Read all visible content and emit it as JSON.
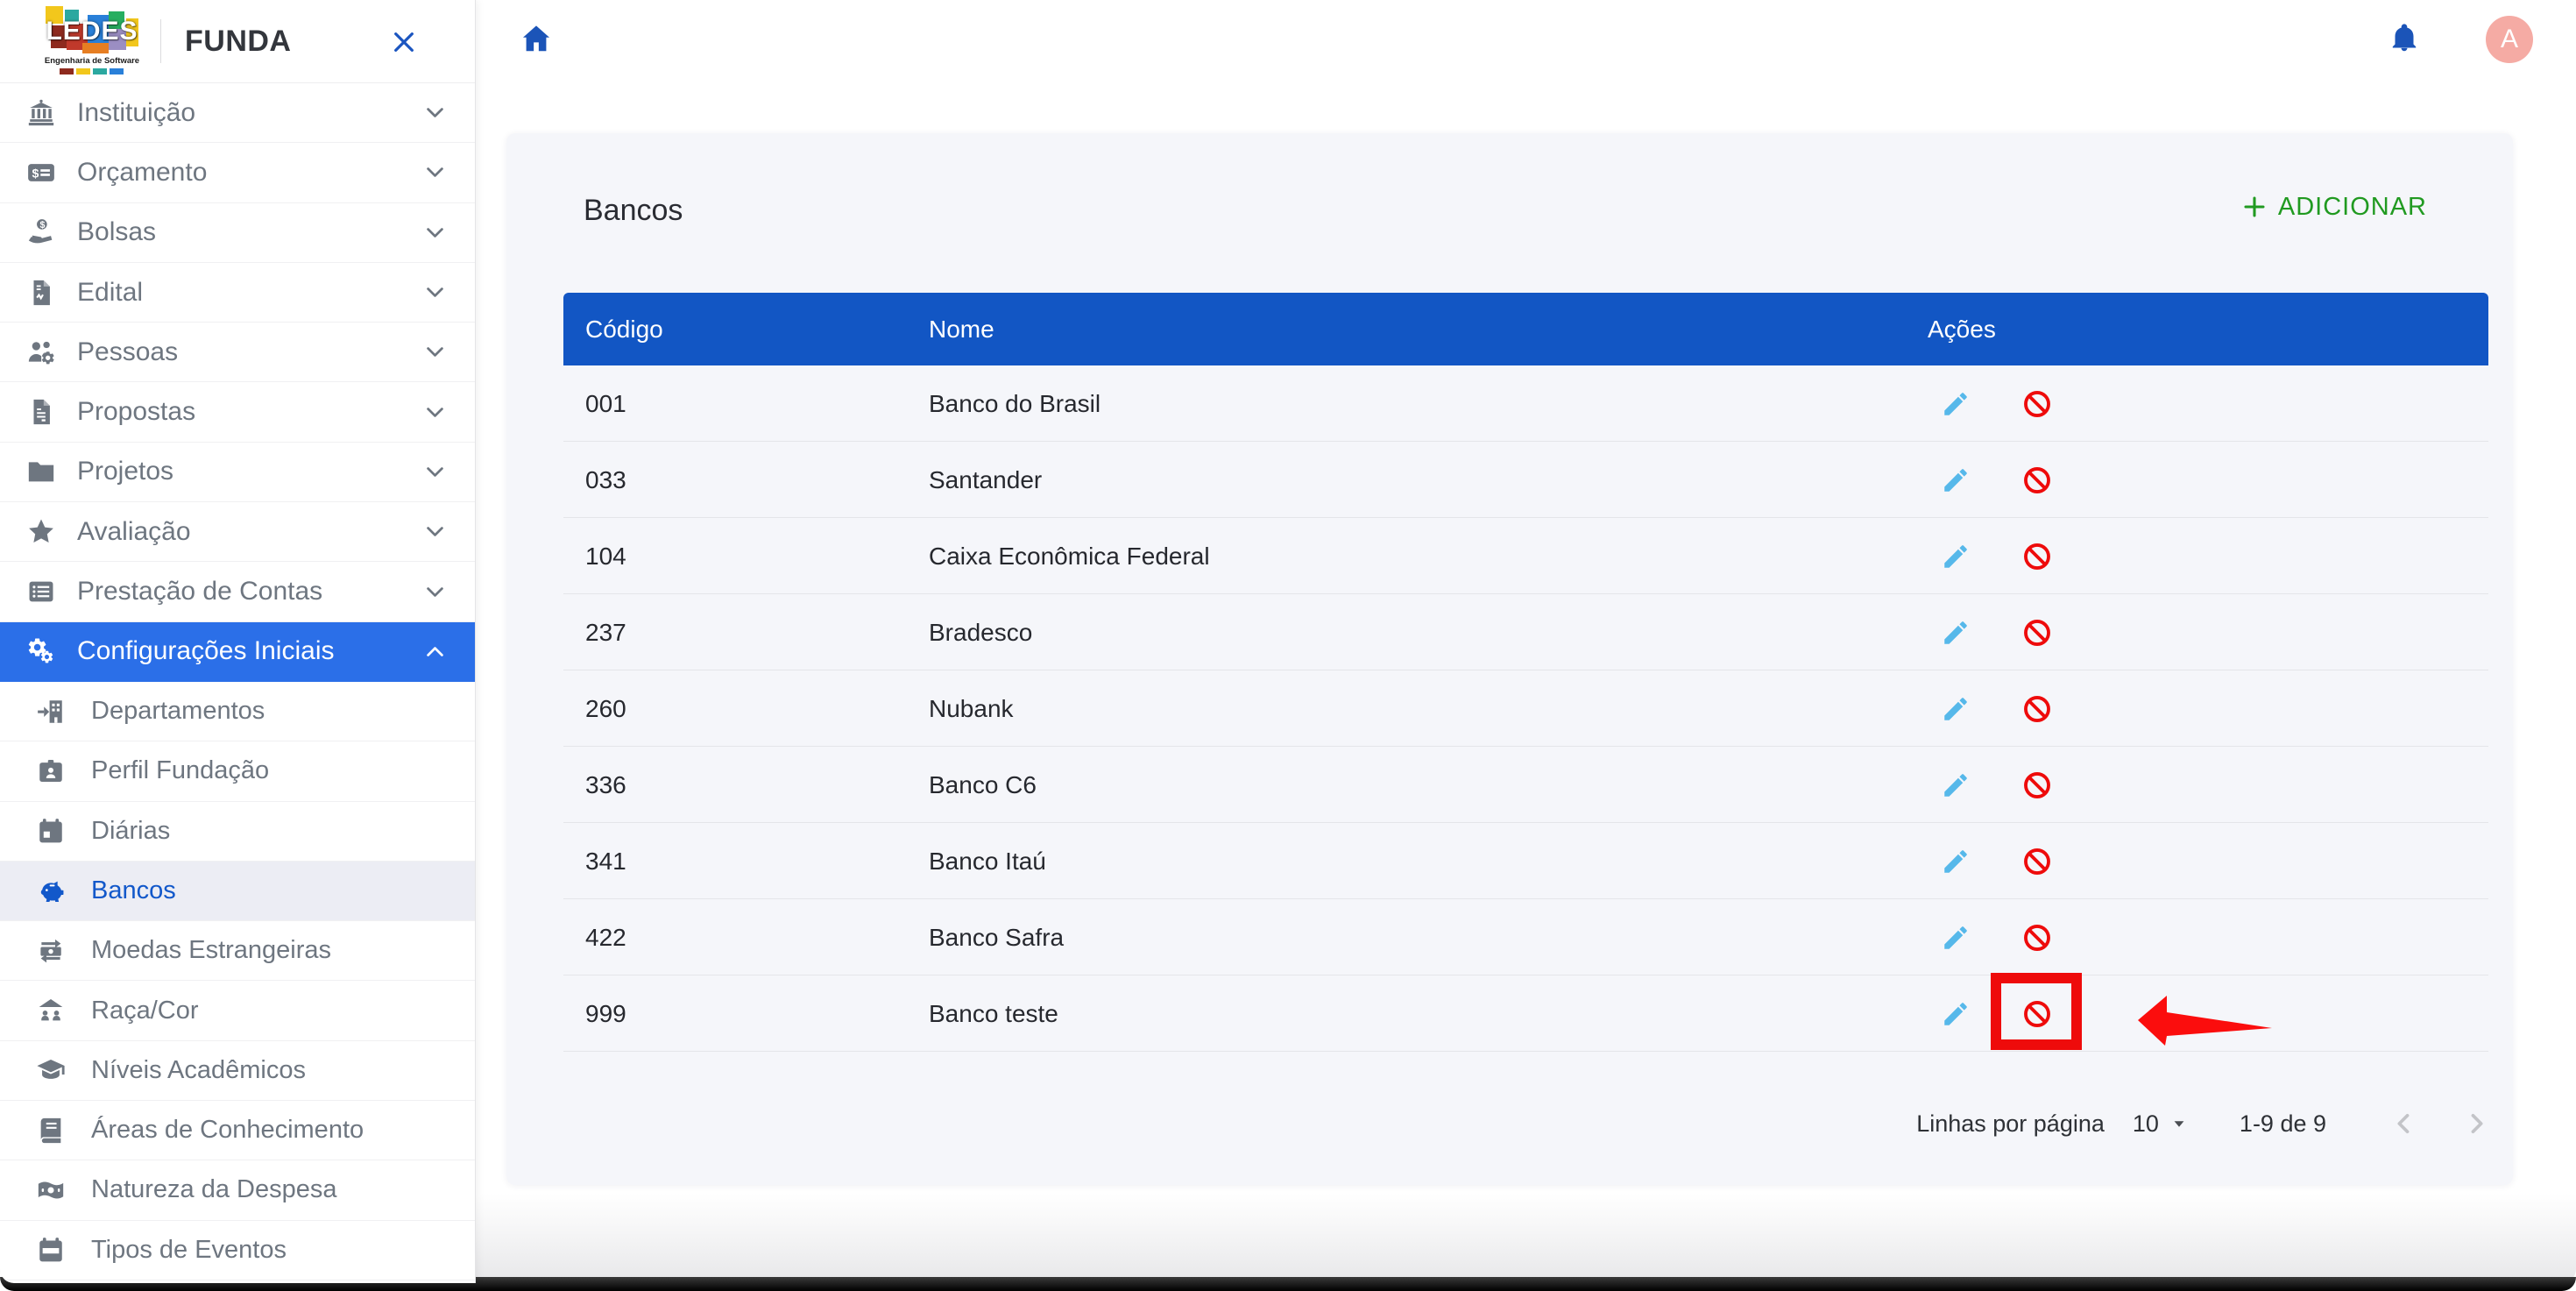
{
  "sidebar": {
    "logo": {
      "text": "LEDES",
      "subtext": "Engenharia de Software"
    },
    "brand": "FUNDA",
    "items": [
      {
        "label": "Instituição",
        "icon": "bank",
        "expanded": false,
        "active": false
      },
      {
        "label": "Orçamento",
        "icon": "moneycheck",
        "expanded": false,
        "active": false
      },
      {
        "label": "Bolsas",
        "icon": "handdollar",
        "expanded": false,
        "active": false
      },
      {
        "label": "Edital",
        "icon": "filewave",
        "expanded": false,
        "active": false
      },
      {
        "label": "Pessoas",
        "icon": "usersgear",
        "expanded": false,
        "active": false
      },
      {
        "label": "Propostas",
        "icon": "filelines",
        "expanded": false,
        "active": false
      },
      {
        "label": "Projetos",
        "icon": "folder",
        "expanded": false,
        "active": false
      },
      {
        "label": "Avaliação",
        "icon": "star",
        "expanded": false,
        "active": false
      },
      {
        "label": "Prestação de Contas",
        "icon": "list",
        "expanded": false,
        "active": false
      },
      {
        "label": "Configurações Iniciais",
        "icon": "gears",
        "expanded": true,
        "active": true
      }
    ],
    "subitems": [
      {
        "label": "Departamentos",
        "icon": "buildingarrow",
        "active": false
      },
      {
        "label": "Perfil Fundação",
        "icon": "idcard",
        "active": false
      },
      {
        "label": "Diárias",
        "icon": "calendarday",
        "active": false
      },
      {
        "label": "Bancos",
        "icon": "piggy",
        "active": true
      },
      {
        "label": "Moedas Estrangeiras",
        "icon": "exchange",
        "active": false
      },
      {
        "label": "Raça/Cor",
        "icon": "peopleroof",
        "active": false
      },
      {
        "label": "Níveis Acadêmicos",
        "icon": "gradcap",
        "active": false
      },
      {
        "label": "Áreas de Conhecimento",
        "icon": "book",
        "active": false
      },
      {
        "label": "Natureza da Despesa",
        "icon": "billwave",
        "active": false
      },
      {
        "label": "Tipos de Eventos",
        "icon": "calendardays",
        "active": false
      }
    ]
  },
  "topbar": {
    "avatar": "A"
  },
  "main": {
    "title": "Bancos",
    "add_label": "ADICIONAR",
    "table": {
      "columns": [
        "Código",
        "Nome",
        "Ações"
      ],
      "rows": [
        {
          "code": "001",
          "name": "Banco do Brasil"
        },
        {
          "code": "033",
          "name": "Santander"
        },
        {
          "code": "104",
          "name": "Caixa Econômica Federal"
        },
        {
          "code": "237",
          "name": "Bradesco"
        },
        {
          "code": "260",
          "name": "Nubank"
        },
        {
          "code": "336",
          "name": "Banco C6"
        },
        {
          "code": "341",
          "name": "Banco Itaú"
        },
        {
          "code": "422",
          "name": "Banco Safra"
        },
        {
          "code": "999",
          "name": "Banco teste"
        }
      ]
    },
    "pagination": {
      "label": "Linhas por página",
      "value": "10",
      "range": "1-9 de 9"
    }
  },
  "colors": {
    "accent_blue": "#1b54b8",
    "sidebar_active_bg": "#2b6fe8",
    "table_header_bg": "#1256c4",
    "active_sub_text": "#1258ca",
    "add_green": "#219a21",
    "ban_red": "#ee0b0b",
    "edit_blue": "#56b8ea",
    "avatar_pink": "#f5aba4",
    "card_bg": "#f5f6fa"
  }
}
